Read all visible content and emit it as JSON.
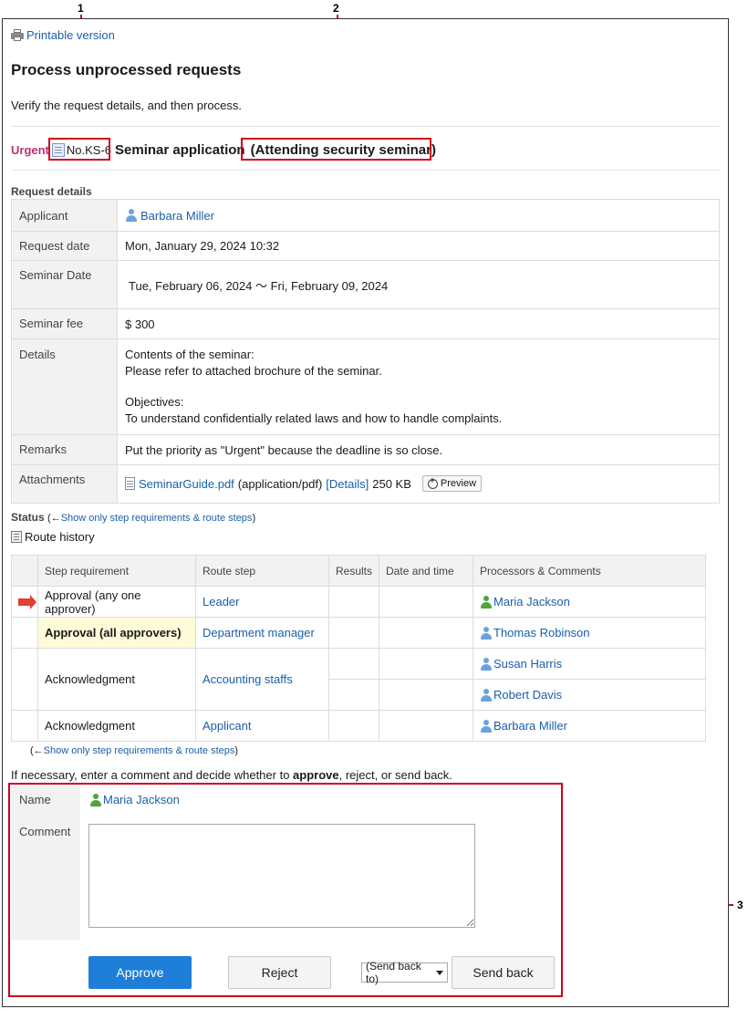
{
  "callouts": {
    "n1": "1",
    "n2": "2",
    "n3": "3"
  },
  "header": {
    "printable_label": "Printable version",
    "title": "Process unprocessed requests",
    "instructions": "Verify the request details, and then process."
  },
  "request": {
    "priority": "Urgent",
    "number": "No.KS-6",
    "title": "Seminar application",
    "subtitle": "(Attending security seminar)"
  },
  "details": {
    "section_label": "Request details",
    "applicant_label": "Applicant",
    "applicant": "Barbara Miller",
    "request_date_label": "Request date",
    "request_date": "Mon, January 29, 2024 10:32",
    "seminar_date_label": "Seminar Date",
    "seminar_date": "Tue, February 06, 2024 〜 Fri, February 09, 2024",
    "seminar_fee_label": "Seminar fee",
    "seminar_fee": "$ 300",
    "details_label": "Details",
    "details_line1": "Contents of the seminar:",
    "details_line2": "Please refer to attached brochure of the seminar.",
    "details_line3": "Objectives:",
    "details_line4": "To understand confidentially related laws and how to handle complaints.",
    "remarks_label": "Remarks",
    "remarks": "Put the priority as \"Urgent\" because the deadline is so close.",
    "attachments_label": "Attachments",
    "file_name": "SeminarGuide.pdf",
    "file_type": "(application/pdf)",
    "file_details": "[Details]",
    "file_size": "250 KB",
    "preview_label": "Preview"
  },
  "status": {
    "label": "Status",
    "open_paren": "(←",
    "link": "Show only step requirements & route steps",
    "close_paren": ")",
    "route_history": "Route history"
  },
  "route": {
    "headers": [
      "Step requirement",
      "Route step",
      "Results",
      "Date and time",
      "Processors & Comments"
    ],
    "rows": [
      {
        "step": "Approval (any one approver)",
        "route": "Leader",
        "processor": "Maria Jackson"
      },
      {
        "step": "Approval (all approvers)",
        "route": "Department manager",
        "processor": "Thomas Robinson"
      },
      {
        "step": "Acknowledgment",
        "route": "Accounting staffs",
        "processor": "Susan Harris",
        "processor2": "Robert Davis"
      },
      {
        "step": "Acknowledgment",
        "route": "Applicant",
        "processor": "Barbara Miller"
      }
    ]
  },
  "bottom_link": {
    "open_paren": "(←",
    "link": "Show only step requirements & route steps",
    "close_paren": ")"
  },
  "decide": {
    "before": "If necessary, enter a comment and decide whether to ",
    "bold": "approve",
    "after": ", reject, or send back."
  },
  "form": {
    "name_label": "Name",
    "name_value": "Maria Jackson",
    "comment_label": "Comment",
    "comment_value": "",
    "approve": "Approve",
    "reject": "Reject",
    "send_back_to": "(Send back to)",
    "send_back": "Send back"
  },
  "colors": {
    "callout_red": "#d0021b",
    "link_blue": "#1a5fa8",
    "approve_blue": "#1f7ed8",
    "urgent": "#c0306f",
    "highlight": "#fdfbd8"
  }
}
